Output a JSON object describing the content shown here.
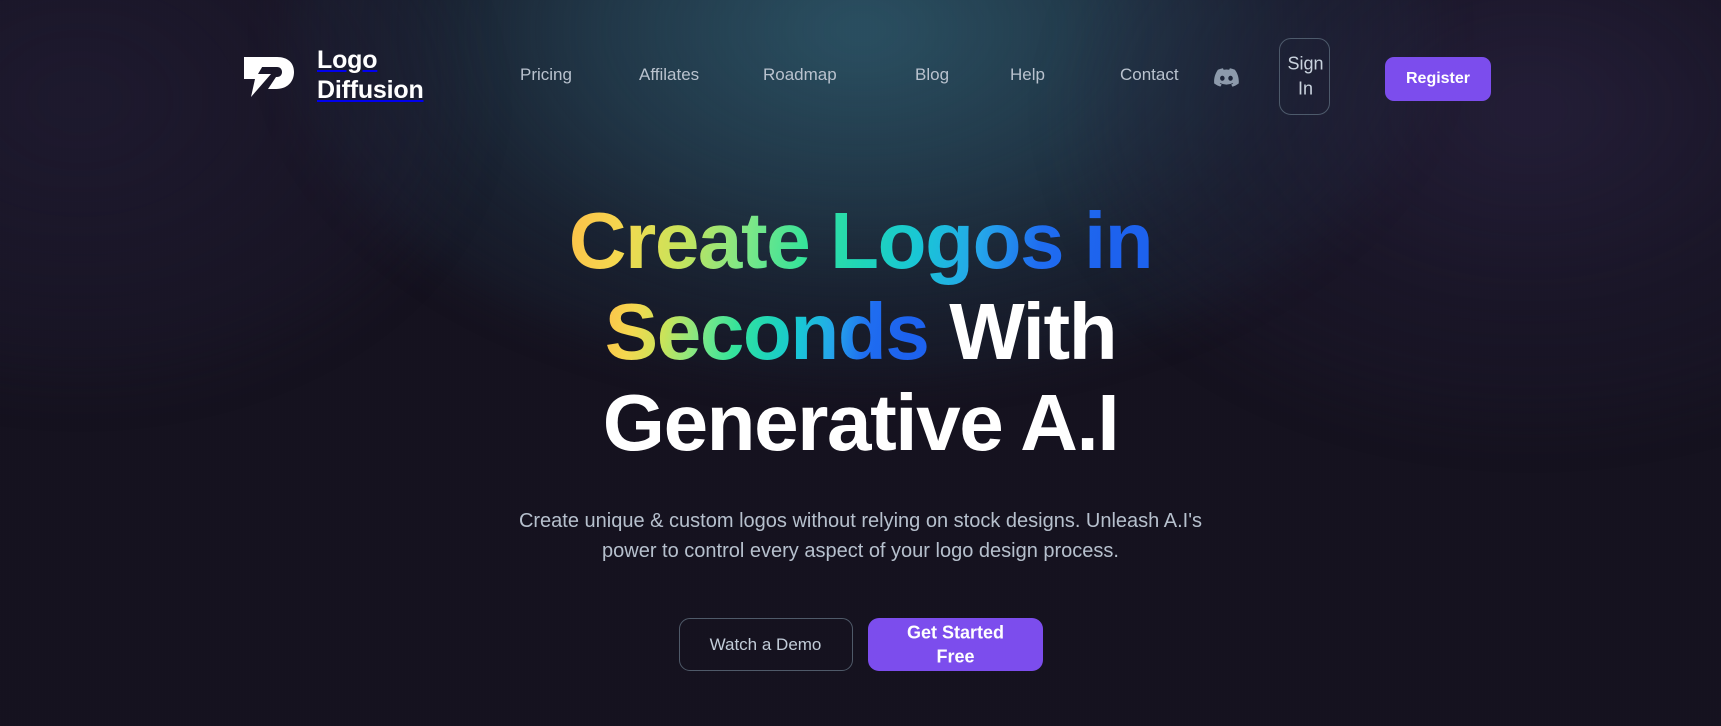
{
  "site": {
    "brand_line1": "Logo",
    "brand_line2": "Diffusion",
    "logo_icon": "lightning-bolt-logo-icon"
  },
  "nav": {
    "items": [
      {
        "label": "Pricing"
      },
      {
        "label": "Affilates"
      },
      {
        "label": "Roadmap"
      },
      {
        "label": "Blog"
      },
      {
        "label": "Help"
      },
      {
        "label": "Contact"
      }
    ],
    "discord_icon": "discord-icon",
    "sign_in_label": "Sign In",
    "register_label": "Register"
  },
  "hero": {
    "title_line1_gradient": "Create Logos in",
    "title_line2_gradient": "Seconds",
    "title_line2_plain": "With",
    "title_line3_plain": "Generative A.I",
    "subtitle": "Create unique & custom logos without relying on stock designs. Unleash A.I's power to control every aspect of your logo design process.",
    "demo_button_label": "Watch a Demo",
    "start_button_label": "Get Started Free"
  },
  "colors": {
    "background_dark": "#15121f",
    "background_glow_teal": "#2c5466",
    "accent_purple": "#7c4ded",
    "nav_link": "#b9c2ce",
    "subtitle": "#b6c0cd",
    "gradient_start": "#fcbf49",
    "gradient_mid_green": "#36e39a",
    "gradient_mid_cyan": "#19c6d6",
    "gradient_end_blue": "#1d62ee",
    "outline_border": "#4f5a69"
  }
}
